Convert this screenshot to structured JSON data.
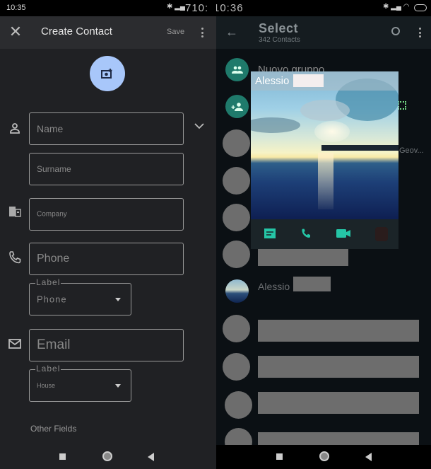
{
  "left_screen": {
    "status_bar": {
      "time": "10:35"
    },
    "app_bar": {
      "title": "Create Contact",
      "save_label": "Save",
      "close_icon": "close-icon",
      "more_icon": "more-vert-icon"
    },
    "photo_button": {
      "icon": "add-photo-icon"
    },
    "fields": {
      "name": {
        "placeholder": "Name"
      },
      "surname": {
        "placeholder": "Surname"
      },
      "company": {
        "placeholder": "Company"
      },
      "phone": {
        "placeholder": "Phone"
      },
      "phone_label": {
        "legend": "Label",
        "value": "Phone"
      },
      "email": {
        "placeholder": "Email"
      },
      "email_label": {
        "legend": "Label",
        "value": "House"
      }
    },
    "other_fields": "Other Fields"
  },
  "right_screen": {
    "status_bar": {
      "time": "10:36"
    },
    "app_bar": {
      "title": "Select",
      "subtitle": "342 Contacts"
    },
    "new_group": "Nuovo gruppo",
    "truncated_text": "Geov...",
    "popup": {
      "contact_name": "Alessio",
      "accent": "#25c5a6"
    },
    "contact_row": {
      "name": "Alessio"
    }
  },
  "colors": {
    "accent_blue": "#a8c7fa",
    "whatsapp_green": "#1f7a6b"
  }
}
